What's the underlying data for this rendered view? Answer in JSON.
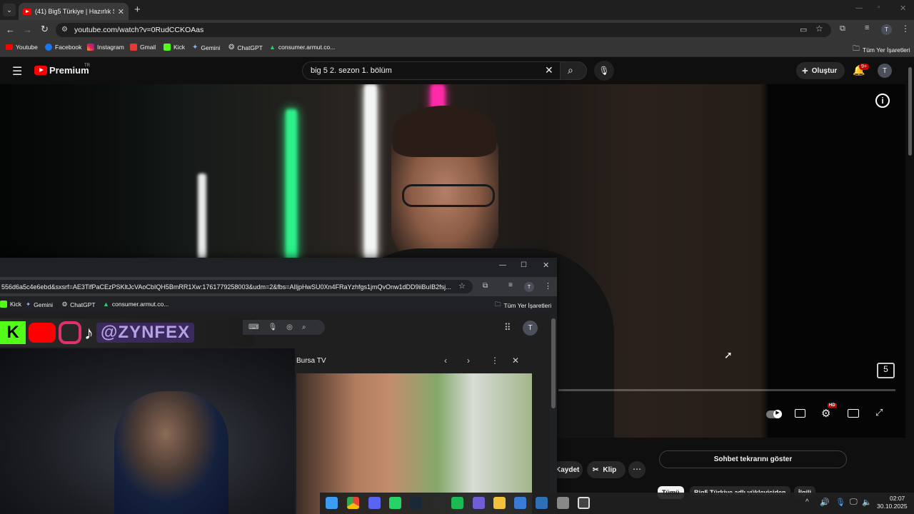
{
  "browser": {
    "tab_title": "(41) Big5 Türkiye | Hazırlık Sezo",
    "new_tab": "+",
    "url": "youtube.com/watch?v=0RudCCKOAas",
    "bookmarks": [
      "Youtube",
      "Facebook",
      "Instagram",
      "Gmail",
      "Kick",
      "Gemini",
      "ChatGPT",
      "consumer.armut.co..."
    ],
    "all_bookmarks": "Tüm Yer İşaretleri",
    "profile_initial": "T"
  },
  "youtube": {
    "logo_text": "Premium",
    "country": "TR",
    "search_value": "big 5 2. sezon 1. bölüm",
    "create_label": "Oluştur",
    "notifications_badge": "9+",
    "avatar_initial": "T",
    "player": {
      "hd_badge": "HD"
    },
    "below": {
      "save_label": "Kaydet",
      "clip_label": "Klip",
      "chat_replay_label": "Sohbet tekrarını göster",
      "chips": [
        "Tümü",
        "Big5 Türkiye adlı yükleyiciden",
        "İlgili"
      ]
    }
  },
  "popup": {
    "url": "556d6a5c4e6ebd&sxsrf=AE3TifPaCEzPSKltJcVAoCbIQH5BmRR1Xw:1761779258003&udm=2&fbs=AIljpHwSU0Xn4FRaYzhfgs1jmQvOnw1dDD9iiBuIB2fsj...",
    "bookmarks": [
      "Kick",
      "Gemini",
      "ChatGPT",
      "consumer.armut.co..."
    ],
    "all_bookmarks": "Tüm Yer İşaretleri",
    "overlay_handle": "@ZYNFEX",
    "profile_initial": "T",
    "image_panel_title": "Bursa TV"
  },
  "taskbar": {
    "time": "02:07",
    "date": "30.10.2025"
  }
}
